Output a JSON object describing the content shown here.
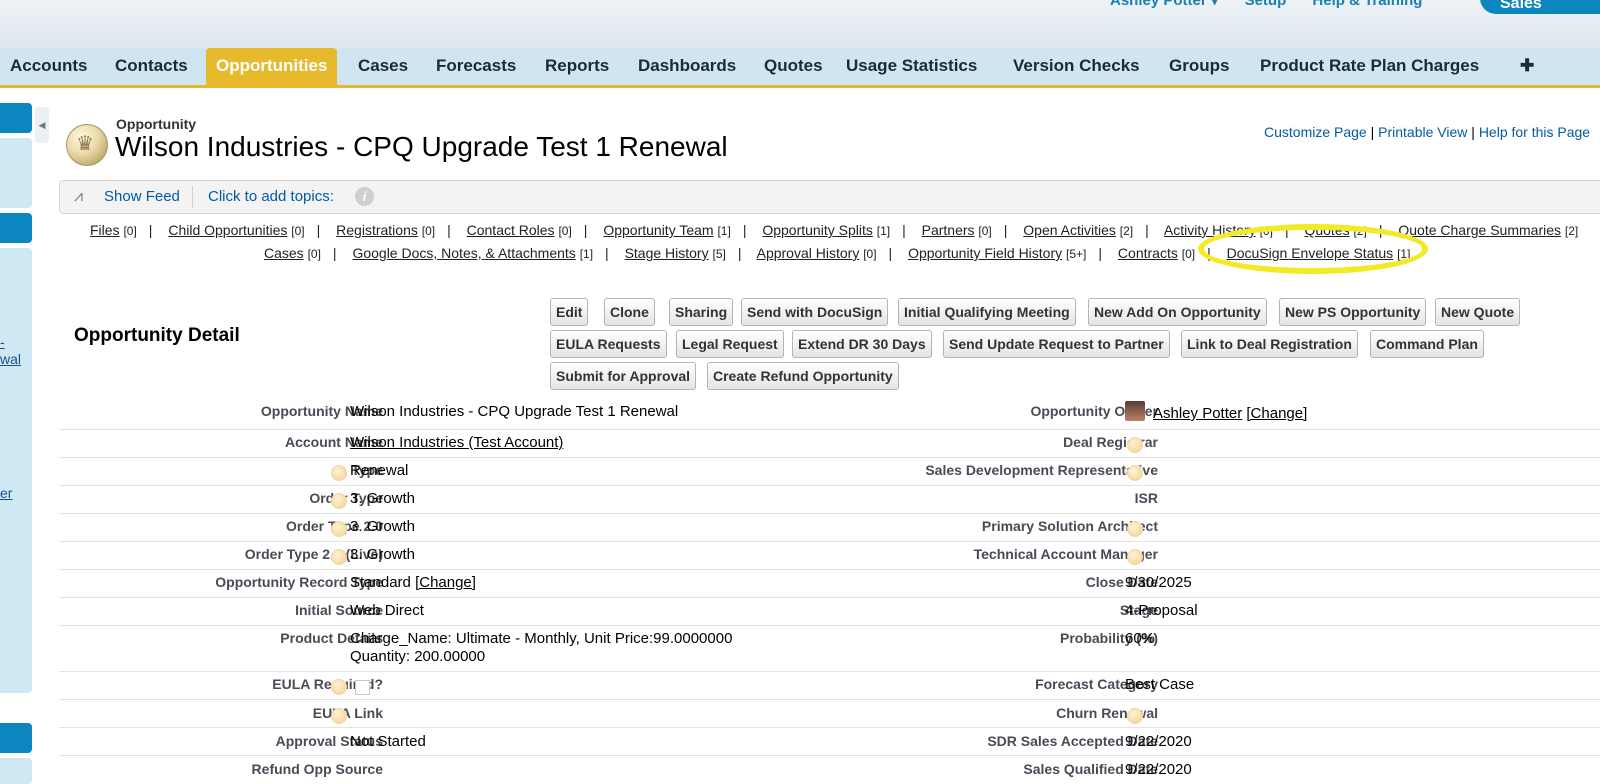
{
  "header": {
    "user_links": [
      "Ashley Potter ▾",
      "Setup",
      "Help & Training"
    ],
    "app_name": "Sales"
  },
  "tabs": [
    {
      "label": "Accounts"
    },
    {
      "label": "Contacts"
    },
    {
      "label": "Opportunities",
      "active": true
    },
    {
      "label": "Cases"
    },
    {
      "label": "Forecasts"
    },
    {
      "label": "Reports"
    },
    {
      "label": "Dashboards"
    },
    {
      "label": "Quotes"
    },
    {
      "label": "Usage Statistics"
    },
    {
      "label": "Version Checks"
    },
    {
      "label": "Groups"
    },
    {
      "label": "Product Rate Plan Charges"
    },
    {
      "label": "✚"
    }
  ],
  "sidebar": {
    "fragments": [
      "-",
      "wal",
      "er"
    ]
  },
  "record": {
    "object_label": "Opportunity",
    "title": "Wilson Industries - CPQ Upgrade Test 1 Renewal",
    "links": [
      "Customize Page",
      "Printable View",
      "Help for this Page"
    ]
  },
  "feed": {
    "show_feed": "Show Feed",
    "add_topics": "Click to add topics:"
  },
  "related_lists": {
    "row1": [
      {
        "label": "Files",
        "count": "[0]"
      },
      {
        "label": "Child Opportunities",
        "count": "[0]"
      },
      {
        "label": "Registrations",
        "count": "[0]"
      },
      {
        "label": "Contact Roles",
        "count": "[0]"
      },
      {
        "label": "Opportunity Team",
        "count": "[1]"
      },
      {
        "label": "Opportunity Splits",
        "count": "[1]"
      },
      {
        "label": "Partners",
        "count": "[0]"
      },
      {
        "label": "Open Activities",
        "count": "[2]"
      },
      {
        "label": "Activity History",
        "count": "[0]"
      },
      {
        "label": "Quotes",
        "count": "[2]"
      },
      {
        "label": "Quote Charge Summaries",
        "count": "[2]"
      }
    ],
    "row2": [
      {
        "label": "Cases",
        "count": "[0]"
      },
      {
        "label": "Google Docs, Notes, & Attachments",
        "count": "[1]"
      },
      {
        "label": "Stage History",
        "count": "[5]"
      },
      {
        "label": "Approval History",
        "count": "[0]"
      },
      {
        "label": "Opportunity Field History",
        "count": "[5+]"
      },
      {
        "label": "Contracts",
        "count": "[0]"
      },
      {
        "label": "DocuSign Envelope Status",
        "count": "[1]"
      }
    ]
  },
  "detail": {
    "section_title": "Opportunity Detail",
    "buttons": [
      "Edit",
      "Clone",
      "Sharing",
      "Send with DocuSign",
      "Initial Qualifying Meeting",
      "New Add On Opportunity",
      "New PS Opportunity",
      "New Quote",
      "EULA Requests",
      "Legal Request",
      "Extend DR 30 Days",
      "Send Update Request to Partner",
      "Link to Deal Registration",
      "Command Plan",
      "Submit for Approval",
      "Create Refund Opportunity"
    ],
    "left_fields": [
      {
        "label": "Opportunity Name",
        "value": "Wilson Industries - CPQ Upgrade Test 1 Renewal"
      },
      {
        "label": "Account Name",
        "value": "Wilson Industries (Test Account)"
      },
      {
        "label": "Type",
        "value": "Renewal"
      },
      {
        "label": "Order Type",
        "value": "3. Growth"
      },
      {
        "label": "Order Type 2.0",
        "value": "3. Growth"
      },
      {
        "label": "Order Type 2.0 (Live)",
        "value": "3. Growth"
      },
      {
        "label": "Opportunity Record Type",
        "value": "Standard",
        "extra": "[Change]"
      },
      {
        "label": "Initial Source",
        "value": "Web Direct"
      },
      {
        "label": "Product Details",
        "value": "Charge_Name: Ultimate - Monthly, Unit Price:99.0000000",
        "value2": "Quantity: 200.00000"
      },
      {
        "label": "EULA Required?",
        "value": ""
      },
      {
        "label": "EULA Link",
        "value": ""
      },
      {
        "label": "Approval Status",
        "value": "Not Started"
      },
      {
        "label": "Refund Opp Source",
        "value": ""
      }
    ],
    "right_fields": [
      {
        "label": "Opportunity Owner",
        "value": "Ashley Potter",
        "extra": "[Change]"
      },
      {
        "label": "Deal Registrar",
        "value": ""
      },
      {
        "label": "Sales Development Representative",
        "value": ""
      },
      {
        "label": "ISR",
        "value": ""
      },
      {
        "label": "Primary Solution Architect",
        "value": ""
      },
      {
        "label": "Technical Account Manager",
        "value": ""
      },
      {
        "label": "Close Date",
        "value": "9/30/2025"
      },
      {
        "label": "Stage",
        "value": "4-Proposal"
      },
      {
        "label": "Probability (%)",
        "value": "60%"
      },
      {
        "label": "Forecast Category",
        "value": "Best Case"
      },
      {
        "label": "Churn Renewal",
        "value": ""
      },
      {
        "label": "SDR Sales Accepted Date",
        "value": "9/22/2020"
      },
      {
        "label": "Sales Qualified Date",
        "value": "9/22/2020"
      }
    ]
  },
  "colors": {
    "accent": "#e7b92c",
    "link": "#015ba7",
    "tab_bg": "#cfe6f1",
    "sidebar": "#0b86bf",
    "highlight": "#f3ea27"
  }
}
